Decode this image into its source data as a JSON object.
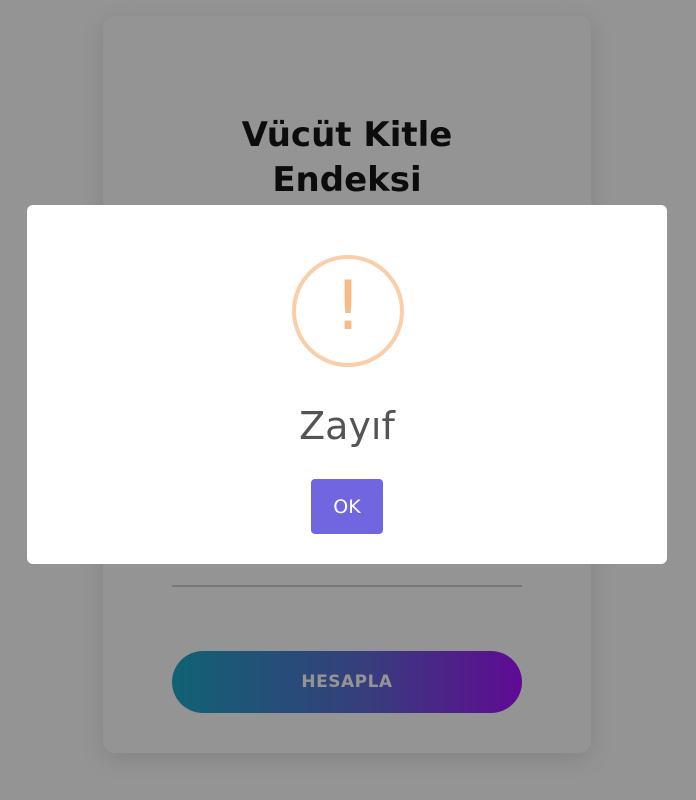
{
  "app": {
    "title_line1": "Vücüt Kitle",
    "title_line2": "Endeksi",
    "calculate_label": "HESAPLA",
    "input_hint": "|"
  },
  "alert": {
    "icon": "exclamation-icon",
    "icon_glyph": "!",
    "title": "Zayıf",
    "confirm_label": "OK"
  },
  "colors": {
    "overlay": "#00000069",
    "warning_ring": "#facea8",
    "warning_mark": "#f8bb86",
    "confirm_button": "#7066e0",
    "gradient_start": "#1ea9c9",
    "gradient_end": "#a512ff"
  }
}
